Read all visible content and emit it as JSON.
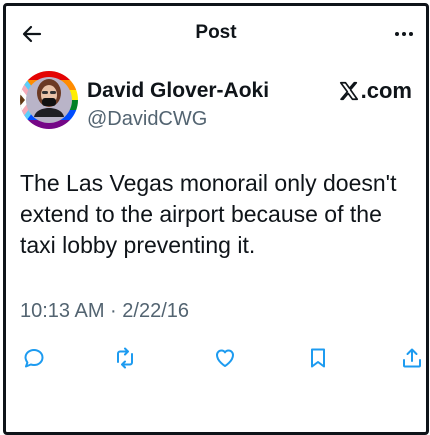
{
  "header": {
    "title": "Post",
    "back_icon": "arrow-left-icon",
    "more_icon": "more-horizontal-icon"
  },
  "author": {
    "name": "David Glover-Aoki",
    "handle": "@DavidCWG"
  },
  "source": {
    "label": ".com",
    "logo_icon": "x-logo-icon"
  },
  "post": {
    "text": "The Las Vegas monorail only doesn't extend to the airport because of the taxi lobby preventing it.",
    "timestamp": "10:13 AM · 2/22/16"
  },
  "actions": {
    "reply_icon": "reply-icon",
    "repost_icon": "repost-icon",
    "like_icon": "heart-icon",
    "bookmark_icon": "bookmark-icon",
    "share_icon": "share-icon"
  },
  "colors": {
    "text": "#0f1419",
    "secondary": "#536471",
    "border": "#0f1419"
  }
}
